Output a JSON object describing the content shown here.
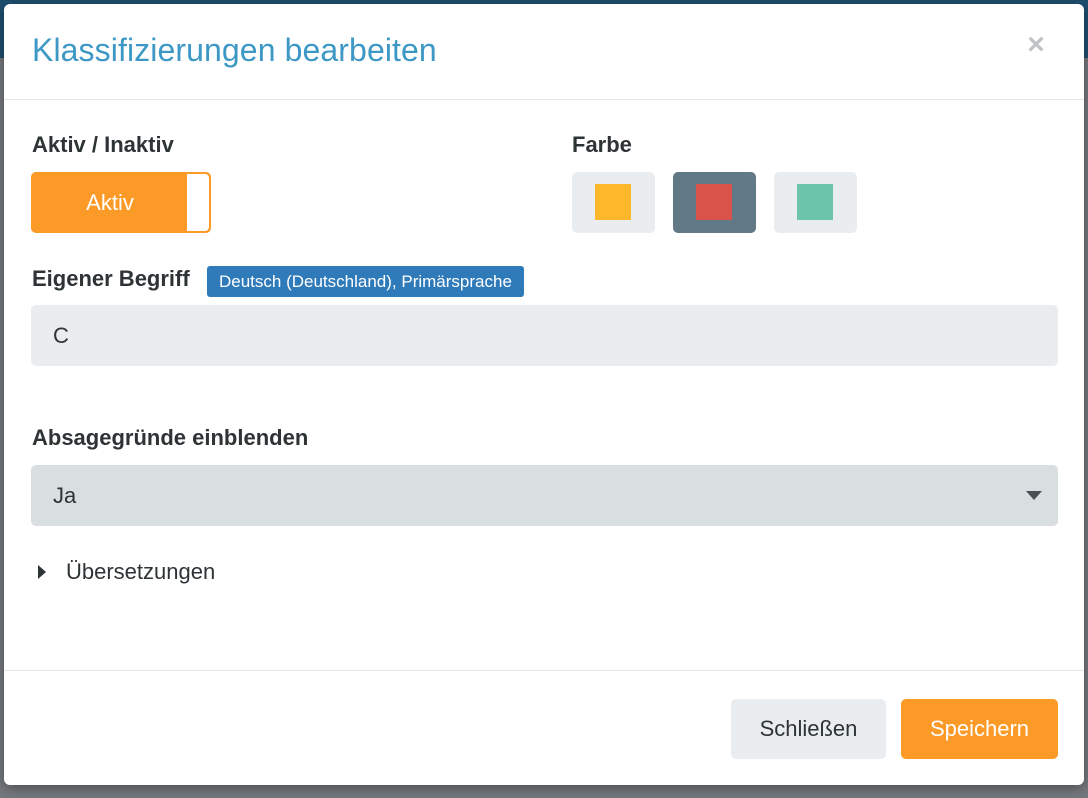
{
  "modal": {
    "title": "Klassifizierungen bearbeiten",
    "close_glyph": "×"
  },
  "status": {
    "label": "Aktiv / Inaktiv",
    "toggle_value": "Aktiv",
    "active": true
  },
  "color": {
    "label": "Farbe",
    "swatches": [
      {
        "name": "orange",
        "hex": "#fdb72a",
        "selected": false
      },
      {
        "name": "red",
        "hex": "#d9534a",
        "selected": true
      },
      {
        "name": "teal",
        "hex": "#6cc4ab",
        "selected": false
      }
    ]
  },
  "term": {
    "label": "Eigener Begriff",
    "language_badge": "Deutsch (Deutschland), Primärsprache",
    "value": "C"
  },
  "rejection_reasons": {
    "label": "Absagegründe einblenden",
    "selected": "Ja"
  },
  "translations": {
    "label": "Übersetzungen",
    "expanded": false
  },
  "footer": {
    "close_label": "Schließen",
    "save_label": "Speichern"
  },
  "colors": {
    "accent": "#fb9a27",
    "title": "#3d98c6",
    "badge": "#2f7ab9"
  }
}
